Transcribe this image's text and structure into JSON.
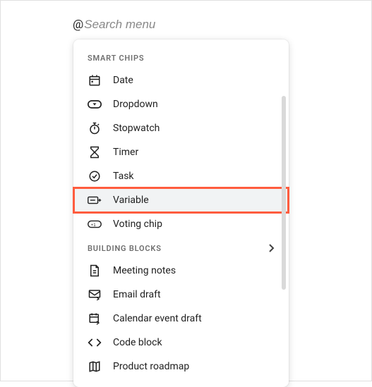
{
  "search": {
    "at": "@",
    "placeholder": "Search menu"
  },
  "sections": [
    {
      "label": "SMART CHIPS",
      "chevron": false,
      "items": [
        {
          "icon": "date-icon",
          "label": "Date",
          "highlighted": false
        },
        {
          "icon": "dropdown-icon",
          "label": "Dropdown",
          "highlighted": false
        },
        {
          "icon": "stopwatch-icon",
          "label": "Stopwatch",
          "highlighted": false
        },
        {
          "icon": "timer-icon",
          "label": "Timer",
          "highlighted": false
        },
        {
          "icon": "task-icon",
          "label": "Task",
          "highlighted": false
        },
        {
          "icon": "variable-icon",
          "label": "Variable",
          "highlighted": true
        },
        {
          "icon": "voting-chip-icon",
          "label": "Voting chip",
          "highlighted": false
        }
      ]
    },
    {
      "label": "BUILDING BLOCKS",
      "chevron": true,
      "items": [
        {
          "icon": "meeting-notes-icon",
          "label": "Meeting notes",
          "highlighted": false
        },
        {
          "icon": "email-draft-icon",
          "label": "Email draft",
          "highlighted": false
        },
        {
          "icon": "calendar-event-draft-icon",
          "label": "Calendar event draft",
          "highlighted": false
        },
        {
          "icon": "code-block-icon",
          "label": "Code block",
          "highlighted": false
        },
        {
          "icon": "product-roadmap-icon",
          "label": "Product roadmap",
          "highlighted": false
        }
      ]
    }
  ]
}
